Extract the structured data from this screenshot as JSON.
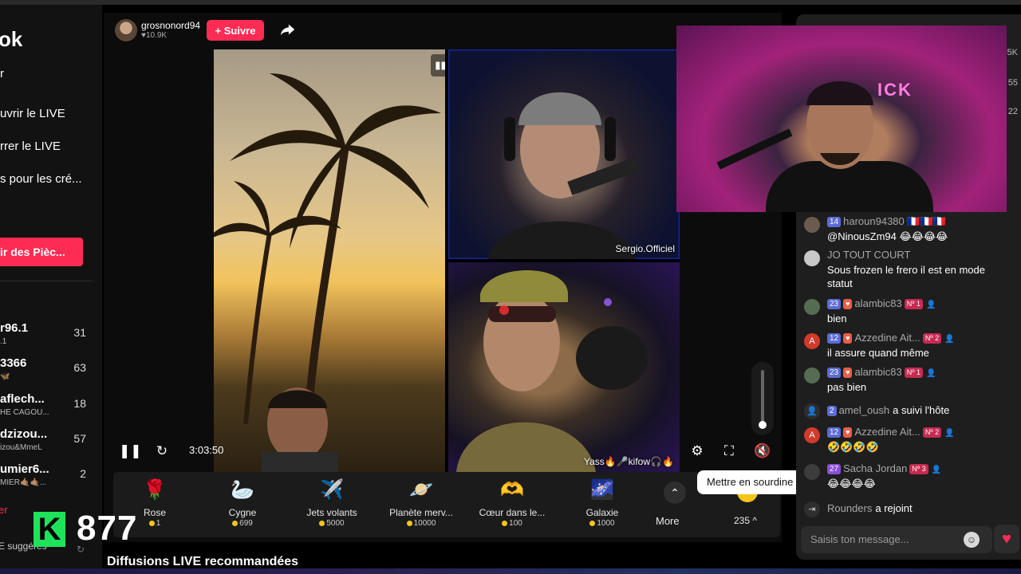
{
  "sidebar": {
    "logo": "ok",
    "nav": [
      "r",
      "uvrir le LIVE",
      "rrer le LIVE",
      "s pour les cré..."
    ],
    "coins_button": "ir des Pièc...",
    "accounts": [
      {
        "name": "r96.1",
        "sub": ".1",
        "count": "31"
      },
      {
        "name": "3366",
        "sub": "🦋",
        "count": "63"
      },
      {
        "name": "aflech...",
        "sub": "HE CAGOU...",
        "count": "18"
      },
      {
        "name": "dzizou...",
        "sub": "izou&MmeL",
        "count": "57"
      },
      {
        "name": "umier6...",
        "sub": "MIER🤙🏽🤙🏽...",
        "count": "2"
      }
    ],
    "see_more": "er",
    "suggested": "E suggérés"
  },
  "viewer_overlay": {
    "badge": "K",
    "count": "877"
  },
  "host": {
    "name": "grosnonord94",
    "likes": "♥10.9K",
    "follow": "+ Suivre"
  },
  "video": {
    "participants": [
      "Sergio.Officiel",
      "Yass🔥🎤kifow🎧🔥"
    ],
    "elapsed": "3:03:50",
    "tooltip": "Mettre en sourdine (M)"
  },
  "gifts": [
    {
      "name": "Rose",
      "price": "1",
      "emoji": "🌹"
    },
    {
      "name": "Cygne",
      "price": "699",
      "emoji": "🦢"
    },
    {
      "name": "Jets volants",
      "price": "5000",
      "emoji": "✈️"
    },
    {
      "name": "Planète merv...",
      "price": "10000",
      "emoji": "🪐"
    },
    {
      "name": "Cœur dans le...",
      "price": "100",
      "emoji": "🫶"
    },
    {
      "name": "Galaxie",
      "price": "1000",
      "emoji": "🌌"
    }
  ],
  "gift_bar": {
    "more": "More",
    "balance": "235 ^"
  },
  "recommended": "Diffusions LIVE recommandées",
  "chat": {
    "side_stats": [
      "5K",
      "55",
      "22"
    ],
    "messages": [
      {
        "level": "14",
        "user": "haroun94380",
        "flags": "🇫🇷🇫🇷🇫🇷",
        "text": "@NinousZm94 😂😂😂😂"
      },
      {
        "user": "JO TOUT COURT",
        "text": "Sous frozen le frero il est en mode statut"
      },
      {
        "level": "23",
        "user": "alambic83",
        "rank": "Nº 1",
        "text": "bien"
      },
      {
        "level": "12",
        "user": "Azzedine Ait...",
        "rank": "Nº 2",
        "text": "il assure quand même",
        "initial": "A"
      },
      {
        "level": "23",
        "user": "alambic83",
        "rank": "Nº 1",
        "text": "pas bien"
      },
      {
        "level": "2",
        "user": "amel_oush",
        "action": "a suivi l'hôte"
      },
      {
        "level": "12",
        "user": "Azzedine Ait...",
        "rank": "Nº 2",
        "text": "🤣🤣🤣🤣",
        "initial": "A"
      },
      {
        "level": "27",
        "user": "Sacha Jordan",
        "rank": "Nº 3",
        "text": "😂😂😂😂"
      },
      {
        "user": "Rounders",
        "action": "a rejoint"
      }
    ],
    "input_placeholder": "Saisis ton message..."
  },
  "colors": {
    "accent": "#fe2c55",
    "viewer_badge": "#1ee35a",
    "chat_bg": "#1e1e1e"
  }
}
